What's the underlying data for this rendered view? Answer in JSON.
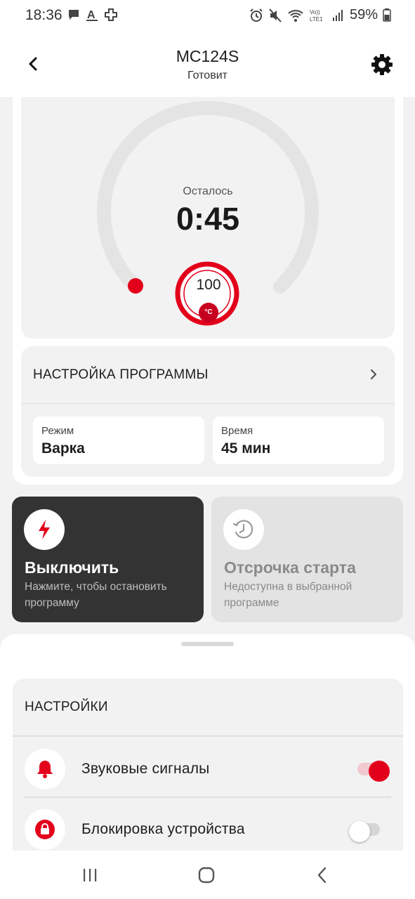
{
  "status_bar": {
    "time": "18:36",
    "battery": "59%",
    "network": "LTE1"
  },
  "header": {
    "title": "MC124S",
    "subtitle": "Готовит"
  },
  "dial": {
    "remaining_label": "Осталось",
    "remaining_value": "0:45",
    "temperature": "100",
    "temperature_unit": "°C",
    "accent_color": "#e3001b"
  },
  "program": {
    "title": "НАСТРОЙКА ПРОГРАММЫ",
    "params": [
      {
        "label": "Режим",
        "value": "Варка"
      },
      {
        "label": "Время",
        "value": "45 мин"
      }
    ]
  },
  "actions": [
    {
      "title": "Выключить",
      "description": "Нажмите, чтобы остановить программу",
      "icon": "lightning-icon",
      "enabled": true
    },
    {
      "title": "Отсрочка старта",
      "description": "Недоступна в выбранной программе",
      "icon": "clock-delay-icon",
      "enabled": false
    }
  ],
  "settings": {
    "title": "НАСТРОЙКИ",
    "items": [
      {
        "label": "Звуковые сигналы",
        "icon": "bell-icon",
        "enabled": true
      },
      {
        "label": "Блокировка устройства",
        "icon": "lock-icon",
        "enabled": false
      }
    ]
  }
}
